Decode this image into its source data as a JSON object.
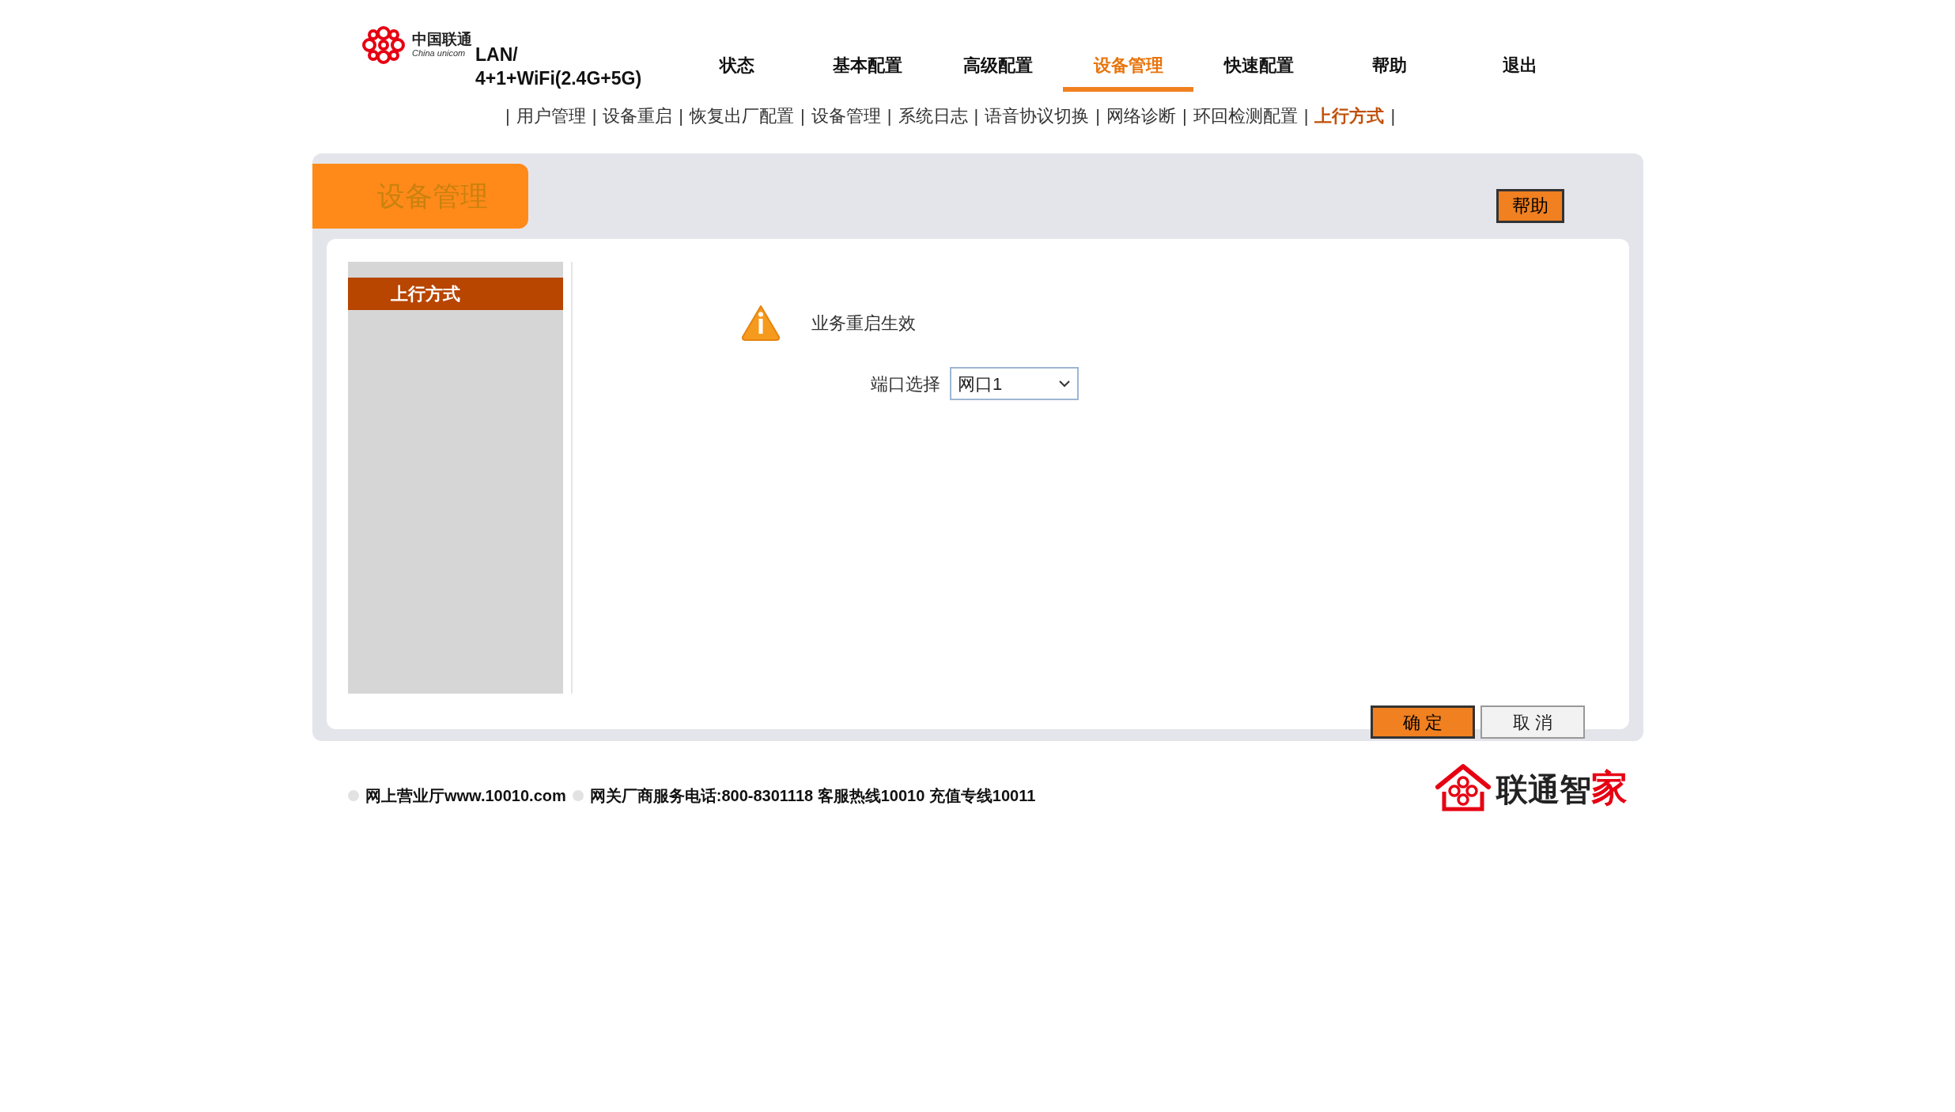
{
  "logo": {
    "title": "中国联通",
    "subtitle": "China unicom"
  },
  "product": [
    "LAN/",
    "4+1+WiFi(2.4G+5G)"
  ],
  "nav": [
    {
      "label": "状态",
      "selected": false
    },
    {
      "label": "基本配置",
      "selected": false
    },
    {
      "label": "高级配置",
      "selected": false
    },
    {
      "label": "设备管理",
      "selected": true
    },
    {
      "label": "快速配置",
      "selected": false
    },
    {
      "label": "帮助",
      "selected": false
    },
    {
      "label": "退出",
      "selected": false
    }
  ],
  "subnav": [
    {
      "kind": "separator",
      "text": "|"
    },
    {
      "kind": "link",
      "text": "用户管理",
      "selected": false
    },
    {
      "kind": "separator",
      "text": "|"
    },
    {
      "kind": "link",
      "text": "设备重启",
      "selected": false
    },
    {
      "kind": "separator",
      "text": "|"
    },
    {
      "kind": "link",
      "text": "恢复出厂配置",
      "selected": false
    },
    {
      "kind": "separator",
      "text": "|"
    },
    {
      "kind": "link",
      "text": "设备管理",
      "selected": false
    },
    {
      "kind": "separator",
      "text": "|"
    },
    {
      "kind": "link",
      "text": "系统日志",
      "selected": false
    },
    {
      "kind": "separator",
      "text": "|"
    },
    {
      "kind": "link",
      "text": "语音协议切换",
      "selected": false
    },
    {
      "kind": "separator",
      "text": "|"
    },
    {
      "kind": "link",
      "text": "网络诊断",
      "selected": false
    },
    {
      "kind": "separator",
      "text": "|"
    },
    {
      "kind": "link",
      "text": "环回检测配置",
      "selected": false
    },
    {
      "kind": "separator",
      "text": "|"
    },
    {
      "kind": "link",
      "text": "上行方式",
      "selected": true
    },
    {
      "kind": "separator",
      "text": "|"
    }
  ],
  "panel": {
    "title": "设备管理",
    "help_button": "帮助"
  },
  "sidebar": {
    "items": [
      {
        "label": "上行方式",
        "selected": true
      }
    ]
  },
  "notice": "业务重启生效",
  "port_select": {
    "label": "端口选择",
    "value": "网口1"
  },
  "buttons": [
    {
      "label": "确 定",
      "kind": "primary"
    },
    {
      "label": "取 消",
      "kind": "secondary"
    }
  ],
  "footer": {
    "links": [
      "网上营业厅www.10010.com",
      "网关厂商服务电话:800-8301118 客服热线10010 充值专线10011"
    ],
    "brand": {
      "text": "联通智",
      "accent": "家"
    }
  }
}
